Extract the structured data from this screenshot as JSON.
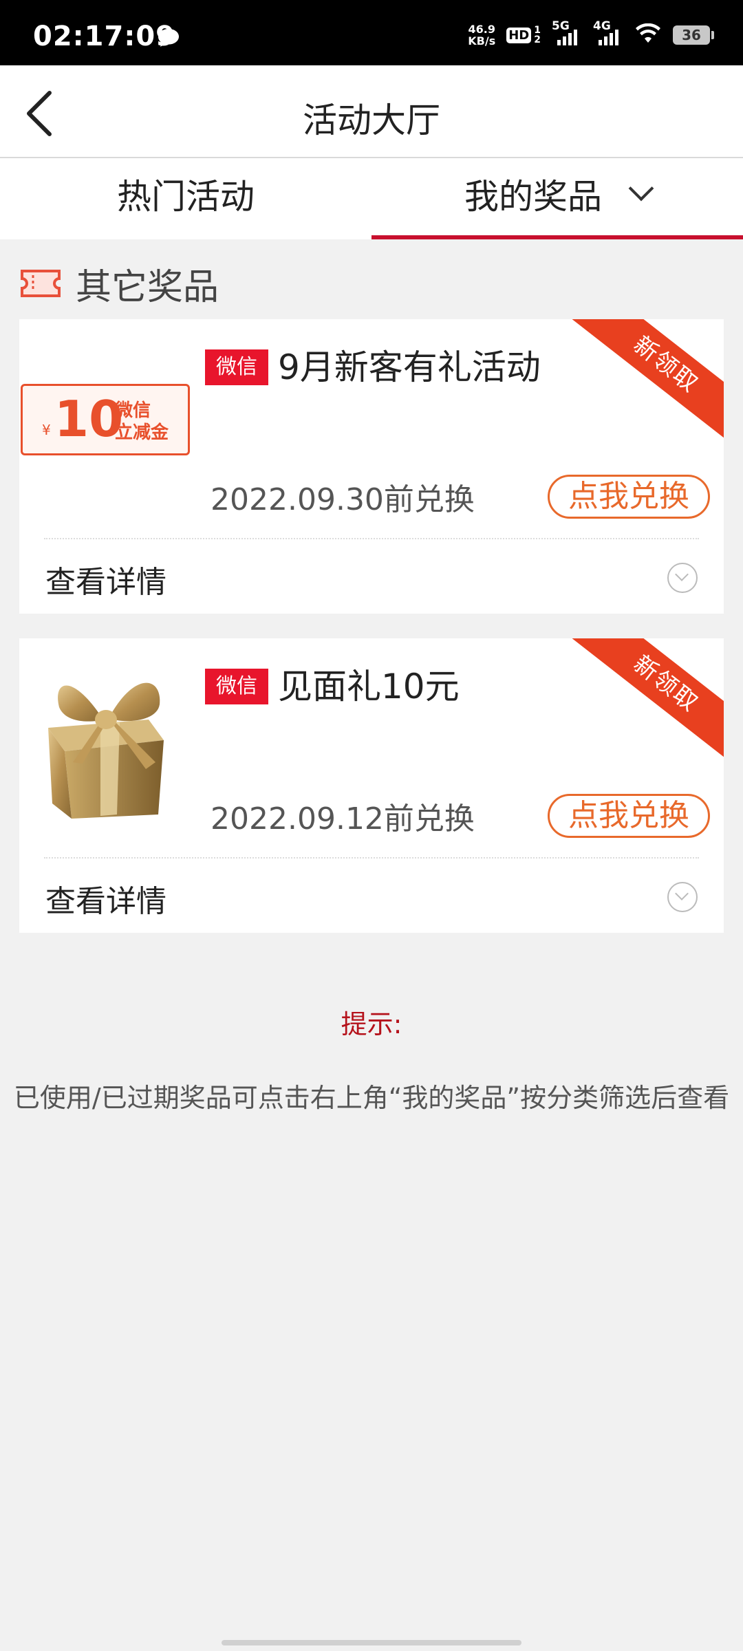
{
  "status_bar": {
    "time": "02:17:09",
    "net_speed_value": "46.9",
    "net_speed_unit": "KB/s",
    "hd_label": "HD",
    "hd_sub_top": "1",
    "hd_sub_bottom": "2",
    "sim1_label": "5G",
    "sim2_label": "4G",
    "battery": "36"
  },
  "header": {
    "title": "活动大厅"
  },
  "tabs": [
    {
      "label": "热门活动",
      "active": false
    },
    {
      "label": "我的奖品",
      "active": true
    }
  ],
  "section": {
    "title": "其它奖品"
  },
  "prizes": [
    {
      "image": "voucher",
      "voucher_currency": "¥",
      "voucher_amount": "10",
      "voucher_line1": "微信",
      "voucher_line2": "立减金",
      "ribbon": "新领取",
      "badge": "微信",
      "name": "9月新客有礼活动",
      "expiry": "2022.09.30前兑换",
      "redeem_label": "点我兑换",
      "details_label": "查看详情"
    },
    {
      "image": "gift-box",
      "ribbon": "新领取",
      "badge": "微信",
      "name": "见面礼10元",
      "expiry": "2022.09.12前兑换",
      "redeem_label": "点我兑换",
      "details_label": "查看详情"
    }
  ],
  "tip": {
    "title": "提示:",
    "text": "已使用/已过期奖品可点击右上角“我的奖品”按分类筛选后查看"
  },
  "colors": {
    "accent_red": "#c8102e",
    "ribbon_orange": "#e8401f",
    "button_orange": "#e8692b",
    "badge_red": "#e8152c"
  }
}
